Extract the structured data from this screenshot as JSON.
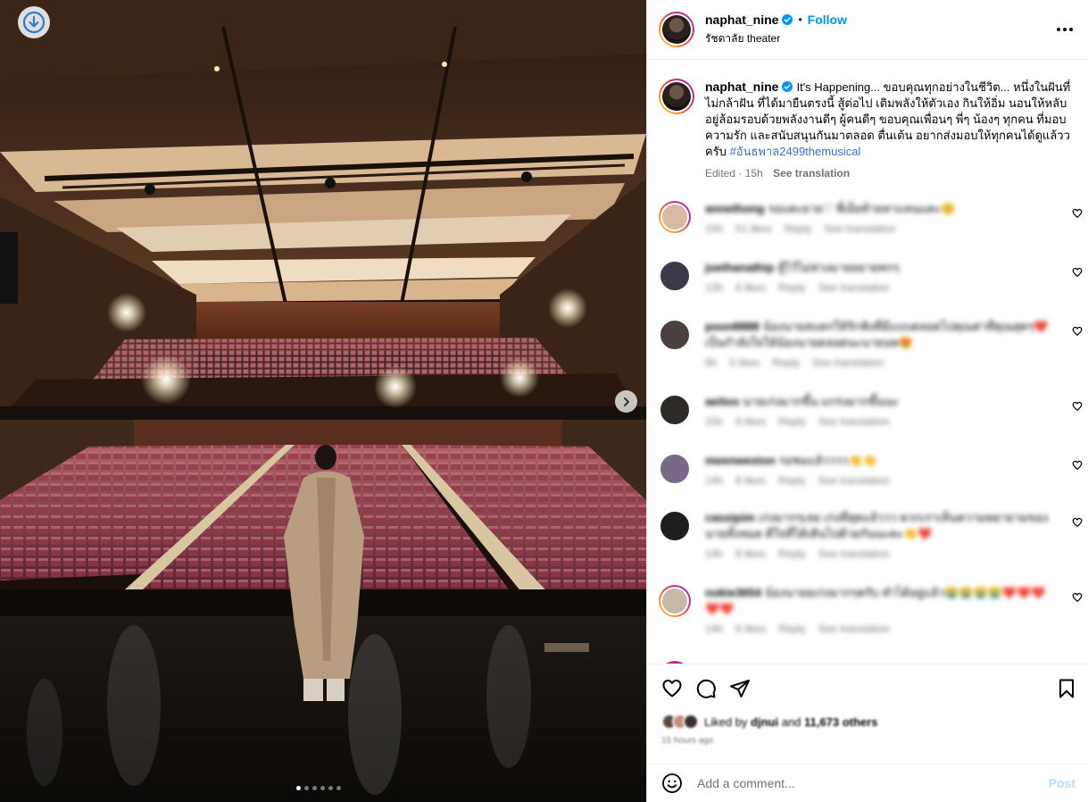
{
  "post": {
    "username": "naphat_nine",
    "follow_label": "Follow",
    "separator": "•",
    "location": "รัชดาลัย theater"
  },
  "caption": {
    "username": "naphat_nine",
    "text": "It's Happening... ขอบคุณทุกอย่างในชีวิต... หนึ่งในฝันที่ไม่กล้าฝัน ที่ได้มายืนตรงนี้ สู้ต่อไป เติมพลังให้ตัวเอง กินให้อิ่ม นอนให้หลับ อยู่ล้อมรอบด้วยพลังงานดีๆ ผู้คนดีๆ ขอบคุณเพื่อนๆ พี่ๆ น้องๆ ทุกคน ที่มอบความรัก และสนับสนุนกันมาตลอด ตื่นเต้น อยากส่งมอบให้ทุกคนได้ดูแล้ววครับ",
    "hashtag": "#อันธพาล2499themusical",
    "edited": "Edited · 15h",
    "see_translation": "See translation"
  },
  "comments": [
    {
      "user": "annethong",
      "text": "รอแตะยาย♡ พี่เย็ยท้ายหาแหนแตะ😊",
      "time": "15h",
      "likes": "51 likes",
      "reply": "Reply",
      "translate": "See translation",
      "color": "#d9b9a4"
    },
    {
      "user": "joethanathip",
      "text": "สู้ไว้ไม่ห่วงมายยยายทกๆ",
      "time": "13h",
      "likes": "6 likes",
      "reply": "Reply",
      "translate": "See translation",
      "color": "#3c3a4a"
    },
    {
      "user": "poon8888",
      "text": "น้องนายสแตกให้รักฟังที่มีแบบตลอดไปคุณค่าที่คุณสุดๆ❤️เป็นกำลังใจให้น้องนายตลอดนะนายนพ😍",
      "time": "6h",
      "likes": "5 likes",
      "reply": "Reply",
      "translate": "See translation",
      "color": "#4a4040"
    },
    {
      "user": "aeitoo",
      "text": "นายเก่งมากขึ้น แกร่งมากขึ้นนะ",
      "time": "15h",
      "likes": "9 likes",
      "reply": "Reply",
      "translate": "See translation",
      "color": "#2e2a28"
    },
    {
      "user": "meenweston",
      "text": "รอชมแล้วววว👏👏",
      "time": "14h",
      "likes": "8 likes",
      "reply": "Reply",
      "translate": "See translation",
      "color": "#7a6a8a"
    },
    {
      "user": "cassipim",
      "text": "เก่งมากๆเลย เก่งที่สุดแล้ววว พวกเราเห็นความพยายามของนายทั้งหมด ดีใจที่ได้เดินไปด้วยกันนะคะ👏❤️",
      "time": "14h",
      "likes": "8 likes",
      "reply": "Reply",
      "translate": "See translation",
      "color": "#1e1e1e"
    },
    {
      "user": "nokie3654",
      "text": "น้องนายยเก่งมากๆครับ ทำได้อยู่แล้ว😭😭😭😭❤️❤️❤️❤️❤️",
      "time": "14h",
      "likes": "6 likes",
      "reply": "Reply",
      "translate": "See translation",
      "color": "#c8b8a8"
    }
  ],
  "likes": {
    "prefix": "Liked by",
    "user": "djnui",
    "and": "and",
    "count": "11,673 others",
    "time": "15 hours ago"
  },
  "add_comment": {
    "placeholder": "Add a comment...",
    "post_label": "Post"
  },
  "carousel": {
    "total": 6,
    "active": 0
  },
  "icons": {
    "download": "download-circle-icon",
    "next": "chevron-right-icon",
    "like": "heart-icon",
    "comment": "comment-bubble-icon",
    "share": "paper-plane-icon",
    "save": "bookmark-icon",
    "emoji": "smiley-icon",
    "more": "more-horizontal-icon"
  },
  "colors": {
    "accent": "#0095f6",
    "hashtag": "#3a6fd0",
    "muted": "#737373",
    "post_disabled": "#b2dffc"
  }
}
